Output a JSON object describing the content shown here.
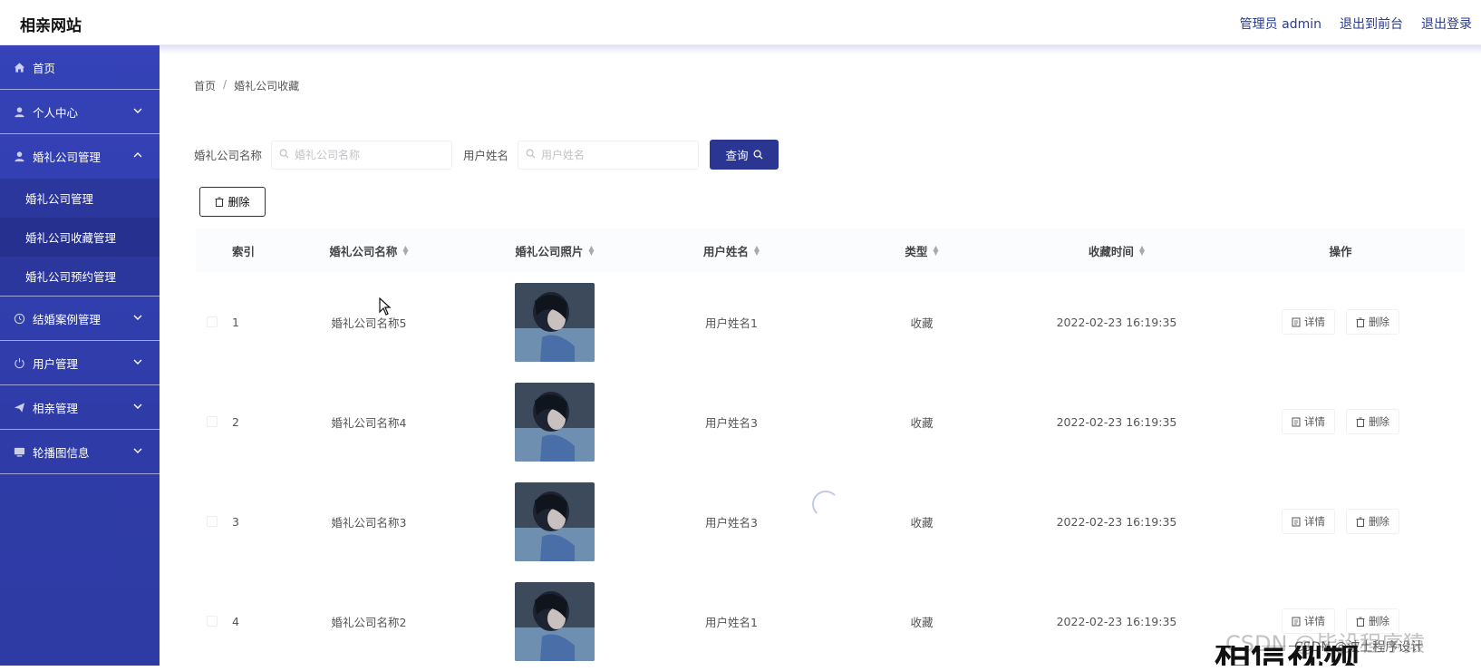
{
  "app": {
    "brand": "相亲网站",
    "admin_label": "管理员 admin",
    "exit_front": "退出到前台",
    "logout": "退出登录"
  },
  "sidebar": {
    "home": "首页",
    "personal": "个人中心",
    "wedding_mgmt": "婚礼公司管理",
    "sub": [
      "婚礼公司管理",
      "婚礼公司收藏管理",
      "婚礼公司预约管理"
    ],
    "cases": "结婚案例管理",
    "users": "用户管理",
    "blind_date": "相亲管理",
    "carousel": "轮播图信息"
  },
  "breadcrumb": {
    "home": "首页",
    "sep": "/",
    "current": "婚礼公司收藏"
  },
  "search": {
    "company_label": "婚礼公司名称",
    "company_placeholder": "婚礼公司名称",
    "user_label": "用户姓名",
    "user_placeholder": "用户姓名",
    "query_label": "查询"
  },
  "toolbar": {
    "delete_label": "删除"
  },
  "table": {
    "headers": {
      "index": "索引",
      "name": "婚礼公司名称",
      "photo": "婚礼公司照片",
      "user": "用户姓名",
      "type": "类型",
      "time": "收藏时间",
      "ops": "操作"
    },
    "ops": {
      "detail": "详情",
      "delete": "删除"
    },
    "rows": [
      {
        "index": "1",
        "name": "婚礼公司名称5",
        "user": "用户姓名1",
        "type": "收藏",
        "time": "2022-02-23 16:19:35"
      },
      {
        "index": "2",
        "name": "婚礼公司名称4",
        "user": "用户姓名3",
        "type": "收藏",
        "time": "2022-02-23 16:19:35"
      },
      {
        "index": "3",
        "name": "婚礼公司名称3",
        "user": "用户姓名3",
        "type": "收藏",
        "time": "2022-02-23 16:19:35"
      },
      {
        "index": "4",
        "name": "婚礼公司名称2",
        "user": "用户姓名1",
        "type": "收藏",
        "time": "2022-02-23 16:19:35"
      }
    ]
  },
  "overlay": {
    "watermark": "CSDN @毕设程序猿",
    "watermark_small": "CSDN @波土程序设计",
    "big_text": "相信视频"
  },
  "colors": {
    "sidebar": "#3542b8",
    "accent": "#2b3692",
    "link": "#2b3b8f"
  }
}
